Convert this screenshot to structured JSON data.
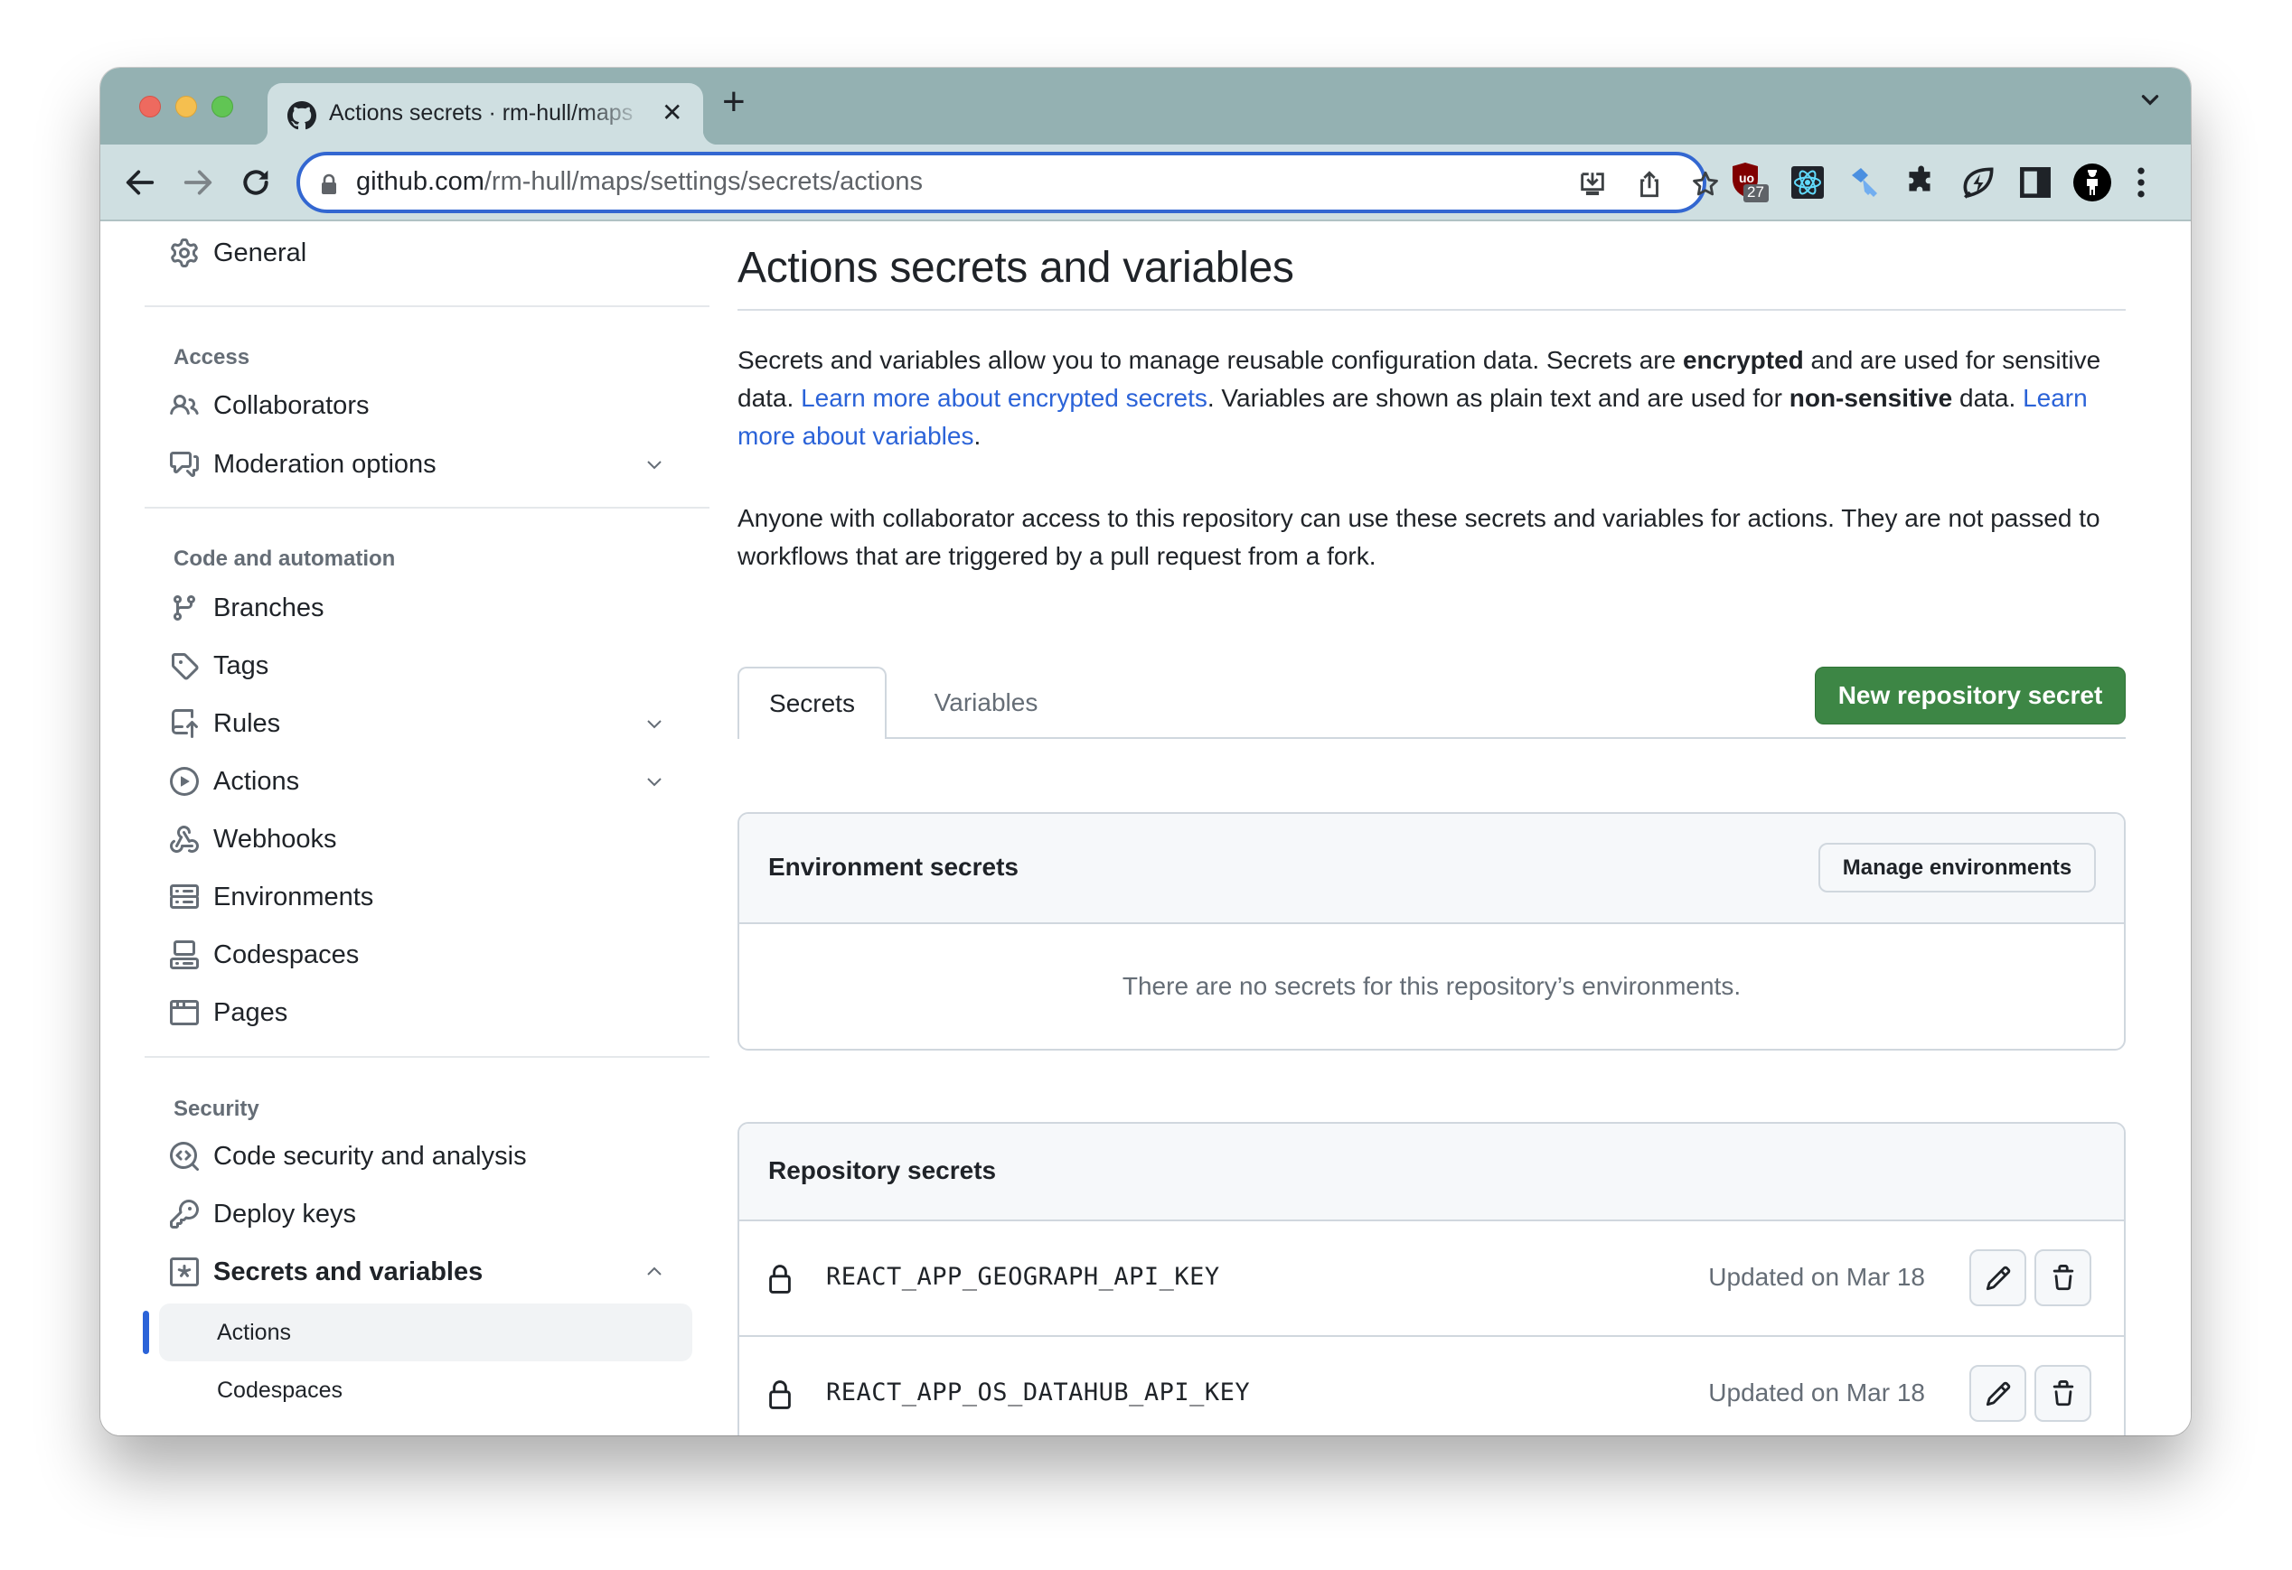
{
  "browser": {
    "tab": {
      "title": "Actions secrets · rm-hull/maps",
      "favicon": "github-icon",
      "close_icon": "close-icon"
    },
    "new_tab_icon": "plus-icon",
    "tab_list_icon": "chevron-down-icon",
    "url": {
      "host": "github.com",
      "path": "/rm-hull/maps/settings/secrets/actions"
    },
    "url_actions": [
      "install-app-icon",
      "share-icon",
      "bookmark-star-icon"
    ],
    "extensions": [
      {
        "name": "ublock-origin-icon",
        "badge": "27"
      },
      {
        "name": "react-devtools-icon"
      },
      {
        "name": "key-extension-icon"
      },
      {
        "name": "extensions-puzzle-icon"
      },
      {
        "name": "leaf-bolt-extension-icon"
      },
      {
        "name": "side-panel-icon"
      },
      {
        "name": "profile-avatar"
      },
      {
        "name": "kebab-menu-icon"
      }
    ]
  },
  "sidebar": {
    "general": {
      "label": "General",
      "icon": "gear-icon"
    },
    "sections": [
      {
        "heading": "Access",
        "items": [
          {
            "label": "Collaborators",
            "icon": "people-icon"
          },
          {
            "label": "Moderation options",
            "icon": "comment-discussion-icon",
            "expandable": true
          }
        ]
      },
      {
        "heading": "Code and automation",
        "items": [
          {
            "label": "Branches",
            "icon": "git-branch-icon"
          },
          {
            "label": "Tags",
            "icon": "tag-icon"
          },
          {
            "label": "Rules",
            "icon": "repo-push-icon",
            "expandable": true
          },
          {
            "label": "Actions",
            "icon": "play-icon",
            "expandable": true
          },
          {
            "label": "Webhooks",
            "icon": "webhook-icon"
          },
          {
            "label": "Environments",
            "icon": "server-icon"
          },
          {
            "label": "Codespaces",
            "icon": "codespaces-icon"
          },
          {
            "label": "Pages",
            "icon": "browser-icon"
          }
        ]
      },
      {
        "heading": "Security",
        "items": [
          {
            "label": "Code security and analysis",
            "icon": "codescan-icon"
          },
          {
            "label": "Deploy keys",
            "icon": "key-icon"
          },
          {
            "label": "Secrets and variables",
            "icon": "key-asterisk-icon",
            "expanded": true,
            "subitems": [
              {
                "label": "Actions",
                "active": true
              },
              {
                "label": "Codespaces"
              }
            ]
          }
        ]
      }
    ]
  },
  "main": {
    "title": "Actions secrets and variables",
    "intro": {
      "p1_a": "Secrets and variables allow you to manage reusable configuration data. Secrets are ",
      "p1_b": "encrypted",
      "p1_c": " and are used for sensitive data. ",
      "link1": "Learn more about encrypted secrets",
      "p1_d": ". Variables are shown as plain text and are used for ",
      "p1_e": "non-sensitive",
      "p1_f": " data. ",
      "link2": "Learn more about variables",
      "p1_g": ".",
      "p2": "Anyone with collaborator access to this repository can use these secrets and variables for actions. They are not passed to workflows that are triggered by a pull request from a fork."
    },
    "tabs": [
      {
        "label": "Secrets",
        "selected": true
      },
      {
        "label": "Variables",
        "selected": false
      }
    ],
    "new_secret_button": "New repository secret",
    "environment_secrets": {
      "title": "Environment secrets",
      "manage_button": "Manage environments",
      "empty_message": "There are no secrets for this repository’s environments."
    },
    "repository_secrets": {
      "title": "Repository secrets",
      "rows": [
        {
          "name": "REACT_APP_GEOGRAPH_API_KEY",
          "updated": "Updated on Mar 18"
        },
        {
          "name": "REACT_APP_OS_DATAHUB_API_KEY",
          "updated": "Updated on Mar 18"
        }
      ]
    }
  },
  "colors": {
    "accent_blue": "#2b63d8",
    "primary_green": "#3d8645",
    "tabstrip": "#94b1b2",
    "toolbar": "#cfdfe1"
  }
}
